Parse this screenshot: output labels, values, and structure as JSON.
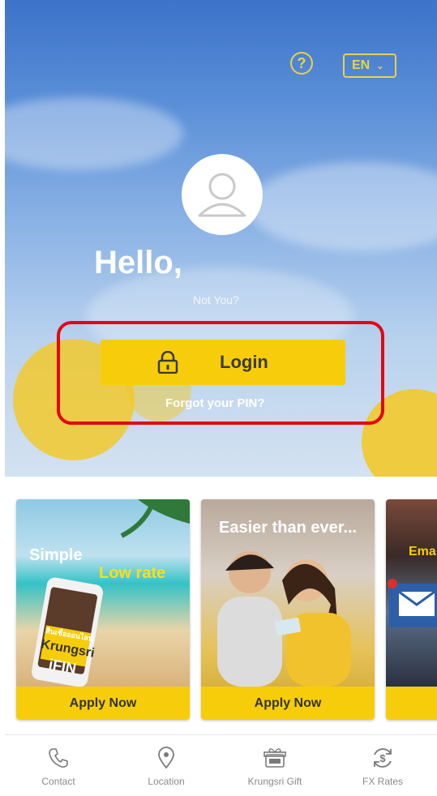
{
  "header": {
    "help_label": "?",
    "language": "EN"
  },
  "greeting": {
    "hello": "Hello,",
    "not_you": "Not You?"
  },
  "auth": {
    "login_label": "Login",
    "forgot_pin": "Forgot your PIN?"
  },
  "promos": [
    {
      "text_main": "Simple",
      "text_accent": "Low rate",
      "brand_small": "สินเชื่อออนไลน์",
      "brand": "Krungsri",
      "brand2": "iFIN",
      "cta": "Apply Now"
    },
    {
      "headline": "Easier than ever...",
      "cta": "Apply Now"
    },
    {
      "headline": "Ema"
    }
  ],
  "bottom_nav": [
    {
      "label": "Contact",
      "icon": "phone-icon"
    },
    {
      "label": "Location",
      "icon": "location-pin-icon"
    },
    {
      "label": "Krungsri Gift",
      "icon": "gift-icon"
    },
    {
      "label": "FX Rates",
      "icon": "fx-rates-icon"
    }
  ],
  "colors": {
    "accent_yellow": "#f7cd0b",
    "highlight_red": "#e30613",
    "icon_yellow": "#e8d24a"
  }
}
